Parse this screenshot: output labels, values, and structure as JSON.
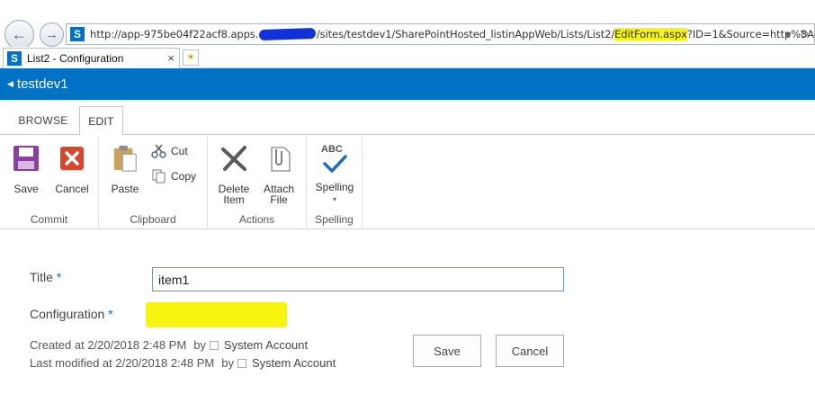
{
  "browser": {
    "url_prefix": "http://app-975be04f22acf8.apps.",
    "url_middle": "/sites/testdev1/SharePointHosted_listinAppWeb/Lists/List2/",
    "url_highlight": "EditForm.aspx",
    "url_suffix": "?ID=1&Source=http%3A",
    "tab_title": "List2 - Configuration",
    "sp_letter": "S",
    "tab_close": "×",
    "back": "←",
    "forward": "→",
    "dropdown": "▾",
    "refresh": "↻"
  },
  "suite": {
    "caret": "◀",
    "site_title": "testdev1"
  },
  "ribbon_tabs": {
    "browse": "BROWSE",
    "edit": "EDIT"
  },
  "ribbon": {
    "commit": {
      "save": "Save",
      "cancel": "Cancel",
      "label": "Commit"
    },
    "clipboard": {
      "paste": "Paste",
      "cut": "Cut",
      "copy": "Copy",
      "label": "Clipboard"
    },
    "actions": {
      "delete_1": "Delete",
      "delete_2": "Item",
      "attach_1": "Attach",
      "attach_2": "File",
      "label": "Actions"
    },
    "spelling": {
      "spelling": "Spelling",
      "abc": "ABC",
      "label": "Spelling"
    }
  },
  "form": {
    "title_label": "Title",
    "title_value": "item1",
    "config_label": "Configuration",
    "required_mark": "*",
    "created_text": "Created at 2/20/2018 2:48 PM",
    "by": "by",
    "created_by": "System Account",
    "modified_text": "Last modified at 2/20/2018 2:48 PM",
    "modified_by": "System Account",
    "save_button": "Save",
    "cancel_button": "Cancel"
  },
  "colors": {
    "accent": "#0072c6",
    "highlight": "#f7f50f",
    "cancel_red": "#d9462e",
    "save_purple": "#7e3a99"
  },
  "icons": {
    "back": "back-arrow-icon",
    "forward": "forward-arrow-icon",
    "sharepoint": "sharepoint-icon",
    "save": "floppy-disk-icon",
    "cancel": "close-icon",
    "paste": "clipboard-icon",
    "cut": "scissors-icon",
    "copy": "copy-icon",
    "delete": "delete-x-icon",
    "attach": "paperclip-icon",
    "spelling": "checkmark-icon"
  }
}
